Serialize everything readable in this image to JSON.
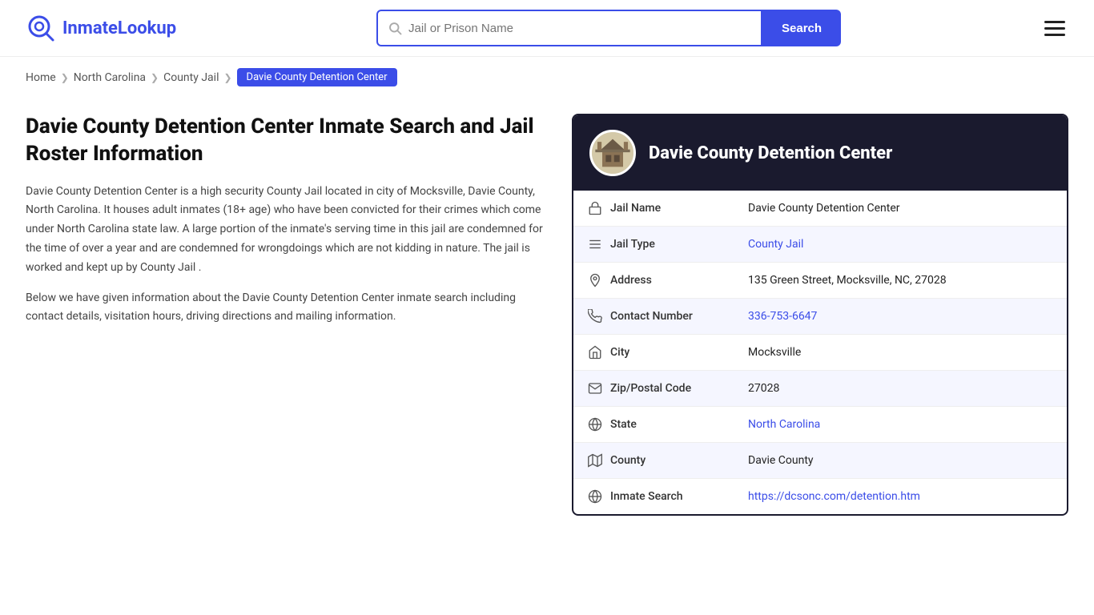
{
  "header": {
    "logo_text_part1": "Inmate",
    "logo_text_part2": "Lookup",
    "search_placeholder": "Jail or Prison Name",
    "search_button_label": "Search"
  },
  "breadcrumb": {
    "home": "Home",
    "nc": "North Carolina",
    "jail_type": "County Jail",
    "current": "Davie County Detention Center"
  },
  "left": {
    "heading": "Davie County Detention Center Inmate Search and Jail Roster Information",
    "desc1": "Davie County Detention Center is a high security County Jail located in city of Mocksville, Davie County, North Carolina. It houses adult inmates (18+ age) who have been convicted for their crimes which come under North Carolina state law. A large portion of the inmate's serving time in this jail are condemned for the time of over a year and are condemned for wrongdoings which are not kidding in nature. The jail is worked and kept up by County Jail .",
    "desc2": "Below we have given information about the Davie County Detention Center inmate search including contact details, visitation hours, driving directions and mailing information."
  },
  "card": {
    "title": "Davie County Detention Center",
    "rows": [
      {
        "icon": "jail-icon",
        "label": "Jail Name",
        "value": "Davie County Detention Center",
        "link": false
      },
      {
        "icon": "type-icon",
        "label": "Jail Type",
        "value": "County Jail",
        "link": true,
        "href": "#"
      },
      {
        "icon": "address-icon",
        "label": "Address",
        "value": "135 Green Street, Mocksville, NC, 27028",
        "link": false
      },
      {
        "icon": "phone-icon",
        "label": "Contact Number",
        "value": "336-753-6647",
        "link": true,
        "href": "tel:336-753-6647"
      },
      {
        "icon": "city-icon",
        "label": "City",
        "value": "Mocksville",
        "link": false
      },
      {
        "icon": "zip-icon",
        "label": "Zip/Postal Code",
        "value": "27028",
        "link": false
      },
      {
        "icon": "state-icon",
        "label": "State",
        "value": "North Carolina",
        "link": true,
        "href": "#"
      },
      {
        "icon": "county-icon",
        "label": "County",
        "value": "Davie County",
        "link": false
      },
      {
        "icon": "inmate-icon",
        "label": "Inmate Search",
        "value": "https://dcsonc.com/detention.htm",
        "link": true,
        "href": "https://dcsonc.com/detention.htm"
      }
    ]
  },
  "icons": {
    "jail-icon": "🏛",
    "type-icon": "☰",
    "address-icon": "📍",
    "phone-icon": "📞",
    "city-icon": "🗺",
    "zip-icon": "✉",
    "state-icon": "🌐",
    "county-icon": "🏷",
    "inmate-icon": "🌐"
  }
}
